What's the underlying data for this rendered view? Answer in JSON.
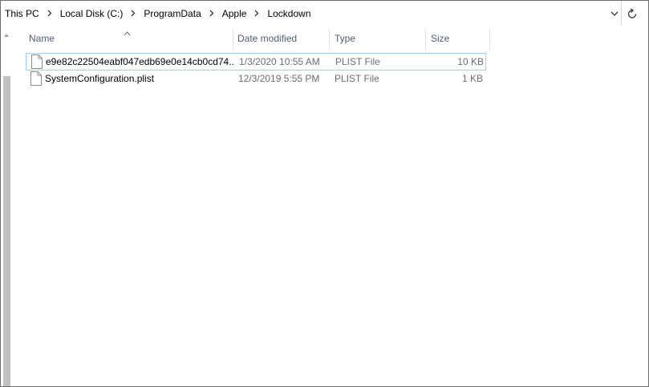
{
  "window_title": "",
  "address_bar": {
    "crumbs": [
      "This PC",
      "Local Disk (C:)",
      "ProgramData",
      "Apple",
      "Lockdown"
    ]
  },
  "columns": {
    "name": "Name",
    "date_modified": "Date modified",
    "type": "Type",
    "size": "Size"
  },
  "files": [
    {
      "name": "e9e82c22504eabf047edb69e0e14cb0cd74...",
      "date_modified": "1/3/2020 10:55 AM",
      "type": "PLIST File",
      "size": "10 KB",
      "icon": "document-icon",
      "focused": true
    },
    {
      "name": "SystemConfiguration.plist",
      "date_modified": "12/3/2019 5:55 PM",
      "type": "PLIST File",
      "size": "1 KB",
      "icon": "document-icon",
      "focused": false
    }
  ],
  "colors": {
    "header_text": "#4c607a",
    "secondary_text": "#6d6d6d",
    "focus_border": "#99d1ff"
  }
}
